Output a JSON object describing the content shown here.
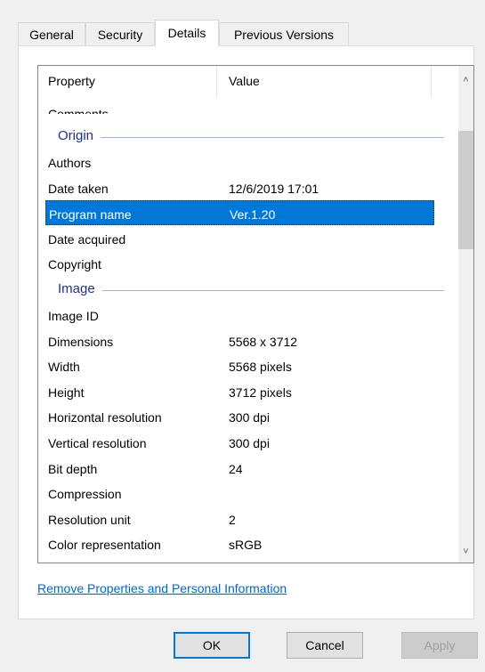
{
  "tabs": [
    {
      "label": "General"
    },
    {
      "label": "Security"
    },
    {
      "label": "Details"
    },
    {
      "label": "Previous Versions"
    }
  ],
  "active_tab": "Details",
  "list": {
    "header": {
      "property": "Property",
      "value": "Value"
    },
    "partial_row": "Comments",
    "groups": [
      {
        "name": "Origin",
        "rows": [
          {
            "property": "Authors",
            "value": ""
          },
          {
            "property": "Date taken",
            "value": "12/6/2019 17:01"
          },
          {
            "property": "Program name",
            "value": "Ver.1.20",
            "selected": true
          },
          {
            "property": "Date acquired",
            "value": ""
          },
          {
            "property": "Copyright",
            "value": ""
          }
        ]
      },
      {
        "name": "Image",
        "rows": [
          {
            "property": "Image ID",
            "value": ""
          },
          {
            "property": "Dimensions",
            "value": "5568 x 3712"
          },
          {
            "property": "Width",
            "value": "5568 pixels"
          },
          {
            "property": "Height",
            "value": "3712 pixels"
          },
          {
            "property": "Horizontal resolution",
            "value": "300 dpi"
          },
          {
            "property": "Vertical resolution",
            "value": "300 dpi"
          },
          {
            "property": "Bit depth",
            "value": "24"
          },
          {
            "property": "Compression",
            "value": ""
          },
          {
            "property": "Resolution unit",
            "value": "2"
          },
          {
            "property": "Color representation",
            "value": "sRGB"
          }
        ]
      }
    ]
  },
  "link": "Remove Properties and Personal Information",
  "buttons": {
    "ok": "OK",
    "cancel": "Cancel",
    "apply": "Apply"
  },
  "colors": {
    "selection": "#0078d7",
    "group_header": "#1e3287",
    "link": "#0066cc"
  },
  "icons": {
    "scroll_up": "chevron-up-icon",
    "scroll_down": "chevron-down-icon"
  }
}
